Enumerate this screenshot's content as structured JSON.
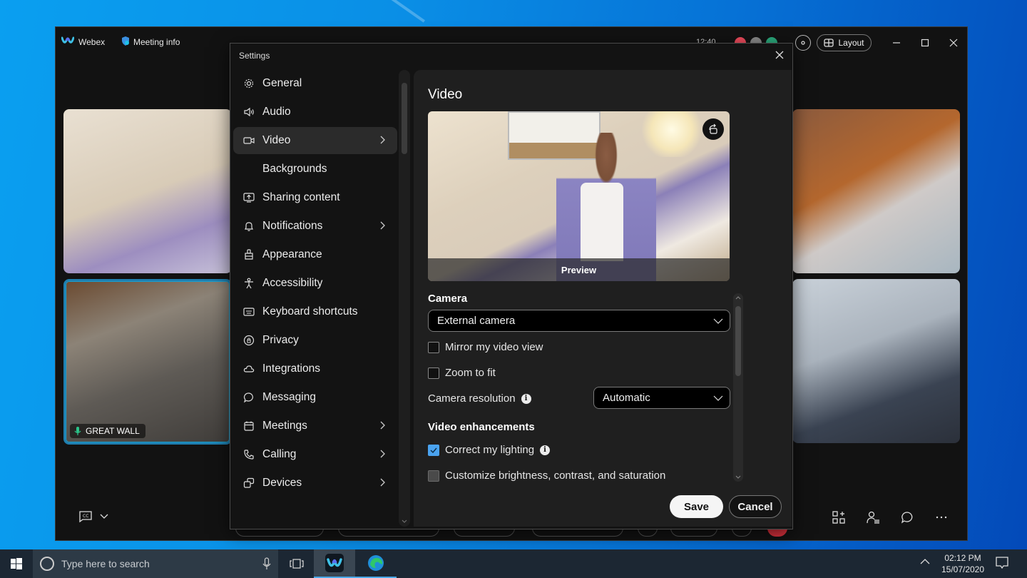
{
  "app": {
    "brand_label": "Webex",
    "meeting_info_label": "Meeting info",
    "time": "12:40",
    "status_dot_colors": [
      "#ef4b5c",
      "#8a8a8a",
      "#2bab7e"
    ],
    "layout_label": "Layout",
    "accent_color": "#1a9fcf"
  },
  "tiles": [
    {
      "name": "",
      "active": false
    },
    {
      "name": "GREAT WALL",
      "active": true
    },
    {
      "name": "",
      "active": false
    },
    {
      "name": "",
      "active": false
    }
  ],
  "settings": {
    "title": "Settings",
    "nav": [
      {
        "label": "General",
        "icon": "gear-icon",
        "chevron": false,
        "active": false,
        "sub": false
      },
      {
        "label": "Audio",
        "icon": "speaker-icon",
        "chevron": false,
        "active": false,
        "sub": false
      },
      {
        "label": "Video",
        "icon": "video-camera-icon",
        "chevron": true,
        "active": true,
        "sub": false
      },
      {
        "label": "Backgrounds",
        "icon": "",
        "chevron": false,
        "active": false,
        "sub": true
      },
      {
        "label": "Sharing content",
        "icon": "share-screen-icon",
        "chevron": false,
        "active": false,
        "sub": false
      },
      {
        "label": "Notifications",
        "icon": "bell-icon",
        "chevron": true,
        "active": false,
        "sub": false
      },
      {
        "label": "Appearance",
        "icon": "paint-brush-icon",
        "chevron": false,
        "active": false,
        "sub": false
      },
      {
        "label": "Accessibility",
        "icon": "accessibility-icon",
        "chevron": false,
        "active": false,
        "sub": false
      },
      {
        "label": "Keyboard shortcuts",
        "icon": "keyboard-icon",
        "chevron": false,
        "active": false,
        "sub": false
      },
      {
        "label": "Privacy",
        "icon": "privacy-lock-icon",
        "chevron": false,
        "active": false,
        "sub": false
      },
      {
        "label": "Integrations",
        "icon": "cloud-icon",
        "chevron": false,
        "active": false,
        "sub": false
      },
      {
        "label": "Messaging",
        "icon": "chat-bubble-icon",
        "chevron": false,
        "active": false,
        "sub": false
      },
      {
        "label": "Meetings",
        "icon": "calendar-icon",
        "chevron": true,
        "active": false,
        "sub": false
      },
      {
        "label": "Calling",
        "icon": "phone-icon",
        "chevron": true,
        "active": false,
        "sub": false
      },
      {
        "label": "Devices",
        "icon": "devices-icon",
        "chevron": true,
        "active": false,
        "sub": false
      }
    ],
    "video": {
      "title": "Video",
      "preview_label": "Preview",
      "camera_section": "Camera",
      "camera_value": "External camera",
      "mirror_label": "Mirror my video view",
      "mirror_checked": false,
      "zoom_fit_label": "Zoom to fit",
      "zoom_fit_checked": false,
      "resolution_label": "Camera resolution",
      "resolution_value": "Automatic",
      "enhancements_section": "Video enhancements",
      "lighting_label": "Correct my lighting",
      "lighting_checked": true,
      "customize_label": "Customize brightness, contrast, and saturation",
      "customize_checked": false
    },
    "save_label": "Save",
    "cancel_label": "Cancel",
    "checkbox_color": "#4aa3f0"
  },
  "taskbar": {
    "search_placeholder": "Type here to search",
    "time": "02:12 PM",
    "date": "15/07/2020"
  }
}
